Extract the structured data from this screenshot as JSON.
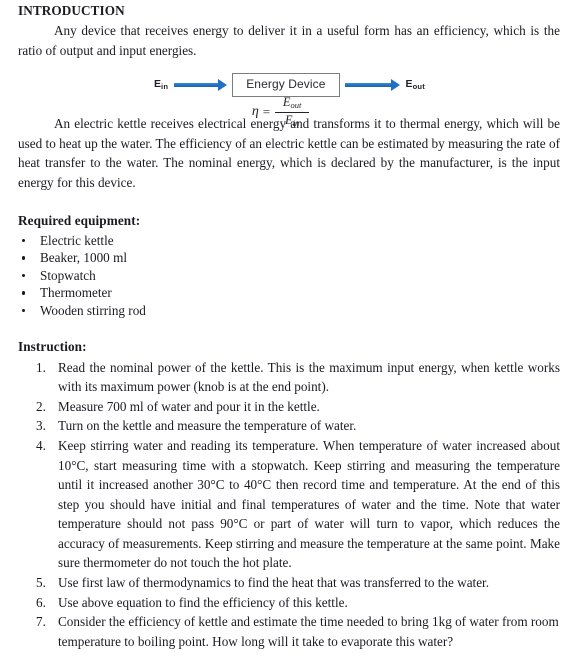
{
  "document": {
    "intro": {
      "heading": "INTRODUCTION",
      "paragraph": "Any device that receives energy to deliver it in a useful form has an efficiency, which is the ratio of output and input energies."
    },
    "diagram": {
      "input_label_base": "E",
      "input_label_sub": "in",
      "device_label": "Energy Device",
      "output_label_base": "E",
      "output_label_sub": "out",
      "arrow_color": "#1f6fc4",
      "box_border_color": "#7d7d7d"
    },
    "equation": {
      "eta": "η",
      "equals": "=",
      "numerator_base": "E",
      "numerator_sub": "out",
      "denominator_base": "E",
      "denominator_sub": "in"
    },
    "kettle_paragraph": "An electric kettle receives electrical energy and transforms it to thermal energy, which will be used to heat up the water. The efficiency of an electric kettle can be estimated by measuring the rate of heat transfer to the water.  The nominal energy, which is declared by the manufacturer, is the input energy for this device.",
    "equipment": {
      "heading": "Required equipment:",
      "items": [
        "Electric kettle",
        "Beaker, 1000 ml",
        "Stopwatch",
        "Thermometer",
        "Wooden stirring rod"
      ]
    },
    "instruction": {
      "heading": "Instruction:",
      "steps": [
        {
          "number": "1.",
          "text": "Read the nominal power of the kettle. This is the maximum input energy, when kettle works with its maximum power (knob is at the end point)."
        },
        {
          "number": "2.",
          "text": "Measure 700 ml of water and pour it in the kettle."
        },
        {
          "number": "3.",
          "text": "Turn on the kettle and measure the temperature of water."
        },
        {
          "number": "4.",
          "text": "Keep stirring water and reading its temperature. When temperature of water increased about 10°C, start measuring time with a stopwatch. Keep stirring and measuring the temperature until it increased another 30°C  to 40°C then record time and temperature. At the end of this step you should have initial and final temperatures of water and the time. Note that water temperature should not pass 90°C or part of water will turn to vapor, which reduces the accuracy of measurements. Keep stirring and measure the temperature at the same point. Make sure thermometer do not touch the hot plate."
        },
        {
          "number": "5.",
          "text": "Use first law of thermodynamics to find the heat that was transferred to the water."
        },
        {
          "number": "6.",
          "text": "Use above equation to find the efficiency of this kettle."
        },
        {
          "number": "7.",
          "text": "Consider the efficiency of kettle and estimate the time needed to bring 1kg of water from room temperature to boiling point. How long will it take to evaporate this water?"
        }
      ]
    }
  }
}
